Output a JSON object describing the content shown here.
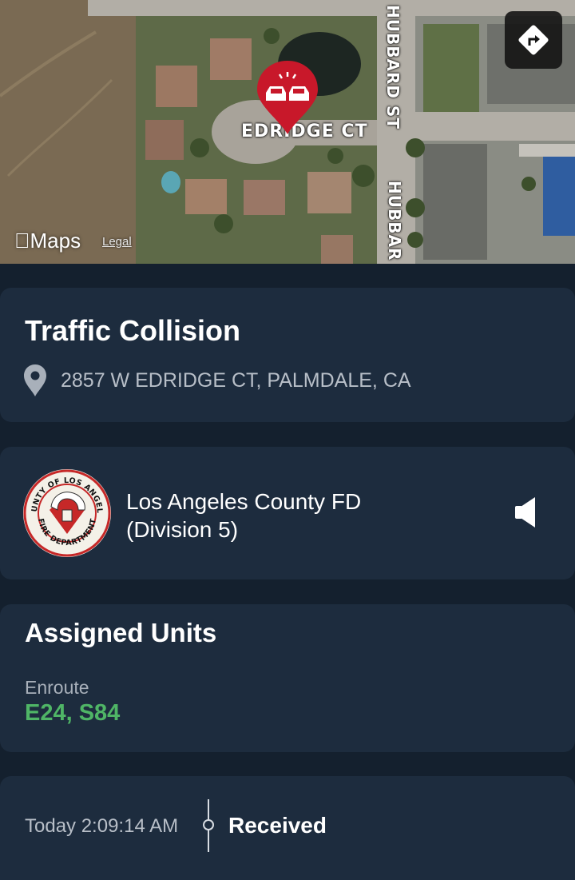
{
  "map": {
    "streets": {
      "edridge": "EDRIDGE CT",
      "hubbard_top": "HUBBARD ST",
      "hubbard_bottom": "HUBBAR"
    },
    "logo": "Maps",
    "legal": "Legal",
    "pin_icon": "car-collision-icon",
    "directions_icon": "directions-arrow-icon"
  },
  "incident": {
    "title": "Traffic Collision",
    "address": "2857 W EDRIDGE CT, PALMDALE, CA"
  },
  "agency": {
    "name_line1": "Los Angeles County FD",
    "name_line2": "(Division 5)",
    "logo_top_text": "COUNTY OF LOS ANGELES",
    "logo_bottom_text": "FIRE DEPARTMENT"
  },
  "units": {
    "title": "Assigned Units",
    "status": "Enroute",
    "list": "E24, S84"
  },
  "timeline": {
    "time": "Today 2:09:14 AM",
    "status": "Received"
  },
  "colors": {
    "background": "#14202e",
    "card": "#1d2c3e",
    "units_green": "#4fb566",
    "pin_red": "#c8182a"
  }
}
